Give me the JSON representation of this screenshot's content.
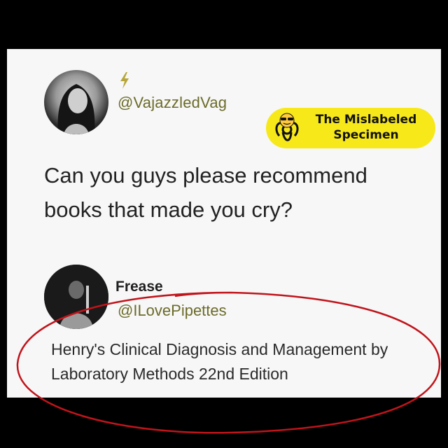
{
  "post": {
    "username": "@VajazzledVag",
    "text": "Can you guys please recommend books that made you cry?"
  },
  "badge": {
    "line1": "The Mislabeled",
    "line2": "Specimen"
  },
  "reply": {
    "display_name": "Frease",
    "username": "@ILovePipettes",
    "text": "Henry's Clinical Diagnosis and Management by Laboratory Methods 22nd Edition"
  },
  "colors": {
    "background": "#000000",
    "card": "#f7f7f7",
    "username": "#6b6b2a",
    "badge": "#f7e81a",
    "circle": "#c0141b"
  },
  "icons": [
    "lightning-icon",
    "biohazard-icon",
    "sunglasses-emoji-icon"
  ]
}
